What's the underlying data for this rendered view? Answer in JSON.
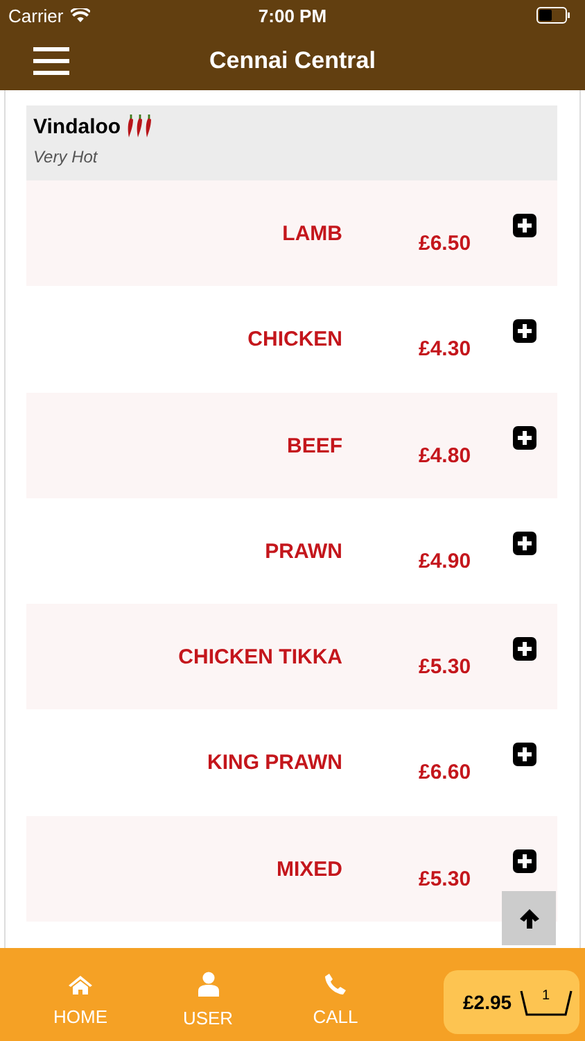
{
  "status_bar": {
    "carrier": "Carrier",
    "time": "7:00 PM"
  },
  "header": {
    "title": "Cennai Central"
  },
  "section": {
    "title": "Vindaloo",
    "subtitle": "Very Hot"
  },
  "items": [
    {
      "name": "LAMB",
      "price": "£6.50"
    },
    {
      "name": "CHICKEN",
      "price": "£4.30"
    },
    {
      "name": "BEEF",
      "price": "£4.80"
    },
    {
      "name": "PRAWN",
      "price": "£4.90"
    },
    {
      "name": "CHICKEN TIKKA",
      "price": "£5.30"
    },
    {
      "name": "KING PRAWN",
      "price": "£6.60"
    },
    {
      "name": "MIXED",
      "price": "£5.30"
    }
  ],
  "tab_bar": [
    {
      "kind": "home",
      "label": "HOME"
    },
    {
      "kind": "user",
      "label": "USER"
    },
    {
      "kind": "call",
      "label": "CALL"
    }
  ],
  "cart": {
    "total": "£2.95",
    "count": "1"
  }
}
